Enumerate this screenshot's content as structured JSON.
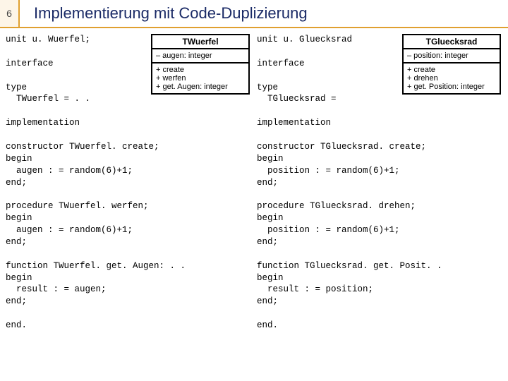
{
  "slide": {
    "number": "6",
    "title": "Implementierung mit Code-Duplizierung"
  },
  "left": {
    "code": "unit u. Wuerfel;\n\ninterface\n\ntype\n  TWuerfel = . .\n\nimplementation\n\nconstructor TWuerfel. create;\nbegin\n  augen : = random(6)+1;\nend;\n\nprocedure TWuerfel. werfen;\nbegin\n  augen : = random(6)+1;\nend;\n\nfunction TWuerfel. get. Augen: . .\nbegin\n  result : = augen;\nend;\n\nend.",
    "uml": {
      "name": "TWuerfel",
      "attr": "– augen: integer",
      "op1": "+ create",
      "op2": "+ werfen",
      "op3": "+ get. Augen: integer"
    }
  },
  "right": {
    "code": "unit u. Gluecksrad\n\ninterface\n\ntype\n  TGluecksrad =\n\nimplementation\n\nconstructor TGluecksrad. create;\nbegin\n  position : = random(6)+1;\nend;\n\nprocedure TGluecksrad. drehen;\nbegin\n  position : = random(6)+1;\nend;\n\nfunction TGluecksrad. get. Posit. .\nbegin\n  result : = position;\nend;\n\nend.",
    "uml": {
      "name": "TGluecksrad",
      "attr": "– position: integer",
      "op1": "+ create",
      "op2": "+ drehen",
      "op3": "+ get. Position: integer"
    }
  }
}
